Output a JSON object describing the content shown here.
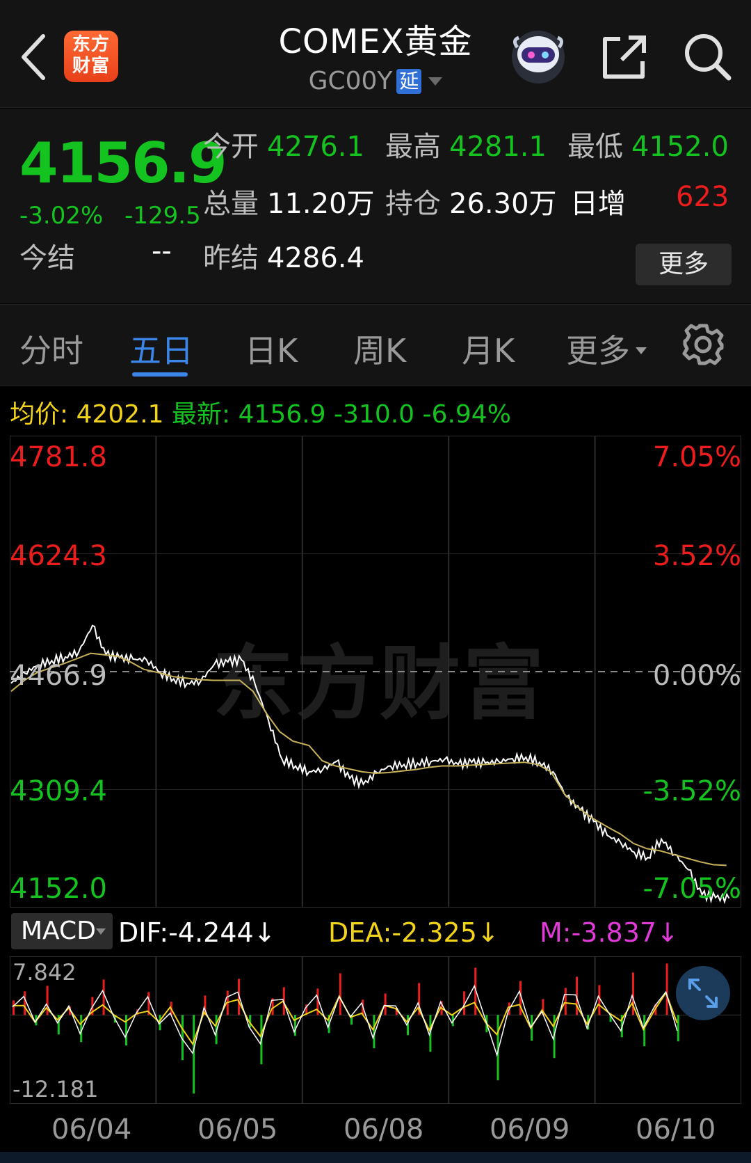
{
  "header": {
    "logo_line1": "东方",
    "logo_line2": "财富",
    "title": "COMEX黄金",
    "code": "GC00Y",
    "delay_badge": "延"
  },
  "quote": {
    "last": "4156.9",
    "change_pct": "-3.02%",
    "change_abs": "-129.5",
    "open_label": "今开",
    "open": "4276.1",
    "high_label": "最高",
    "high": "4281.1",
    "low_label": "最低",
    "low": "4152.0",
    "volume_label": "总量",
    "volume": "11.20万",
    "oi_label": "持仓",
    "oi": "26.30万",
    "daily_inc_label": "日增",
    "daily_inc": "623",
    "settle_label": "今结",
    "settle": "--",
    "prev_settle_label": "昨结",
    "prev_settle": "4286.4",
    "more_label": "更多"
  },
  "tabs": [
    {
      "label": "分时"
    },
    {
      "label": "五日"
    },
    {
      "label": "日K"
    },
    {
      "label": "周K"
    },
    {
      "label": "月K"
    },
    {
      "label": "更多"
    }
  ],
  "active_tab": "五日",
  "infoline": {
    "avg_label": "均价:",
    "avg": "4202.1",
    "latest_label": "最新:",
    "latest": "4156.9",
    "latest_change": "-310.0",
    "latest_pct": "-6.94%"
  },
  "watermark": "东方财富",
  "chart_data": {
    "type": "line",
    "y_left_ticks": [
      "4781.8",
      "4624.3",
      "4466.9",
      "4309.4",
      "4152.0"
    ],
    "y_right_ticks": [
      "7.05%",
      "3.52%",
      "0.00%",
      "-3.52%",
      "-7.05%"
    ],
    "ylim": [
      4152.0,
      4781.8
    ],
    "reference": 4466.9,
    "categories": [
      "06/04",
      "06/05",
      "06/08",
      "06/09",
      "06/10"
    ],
    "series": [
      {
        "name": "price",
        "color": "#ffffff",
        "values": [
          4451,
          4465,
          4476,
          4482,
          4487,
          4494,
          4530,
          4490,
          4486,
          4484,
          4483,
          4466,
          4457,
          4451,
          4454,
          4477,
          4480,
          4483,
          4450,
          4400,
          4347,
          4338,
          4330,
          4333,
          4344,
          4321,
          4313,
          4329,
          4338,
          4340,
          4342,
          4344,
          4347,
          4340,
          4343,
          4342,
          4344,
          4348,
          4350,
          4343,
          4330,
          4296,
          4278,
          4262,
          4243,
          4233,
          4220,
          4213,
          4238,
          4217,
          4196,
          4162,
          4158,
          4157
        ]
      },
      {
        "name": "avg",
        "color": "#c8b25a",
        "values": [
          4440,
          4455,
          4466,
          4472,
          4478,
          4485,
          4492,
          4490,
          4488,
          4480,
          4470,
          4465,
          4460,
          4458,
          4456,
          4455,
          4455,
          4455,
          4440,
          4410,
          4385,
          4372,
          4366,
          4345,
          4338,
          4334,
          4330,
          4328,
          4329,
          4331,
          4333,
          4336,
          4338,
          4338,
          4339,
          4340,
          4341,
          4342,
          4343,
          4340,
          4330,
          4300,
          4282,
          4268,
          4255,
          4245,
          4232,
          4225,
          4222,
          4217,
          4212,
          4207,
          4203,
          4202
        ]
      }
    ]
  },
  "macd": {
    "indicator": "MACD",
    "dif_label": "DIF:-4.244↓",
    "dea_label": "DEA:-2.325↓",
    "m_label": "M:-3.837↓",
    "max_label": "7.842",
    "min_label": "-12.181",
    "ylim": [
      -12.181,
      7.842
    ],
    "colors": {
      "up": "#ee1d1d",
      "down": "#14c31f",
      "dif": "#ffffff",
      "dea": "#f2d319"
    },
    "hist": [
      2.1,
      3.4,
      -1.5,
      4.2,
      -2.8,
      1.2,
      -3.9,
      2.6,
      5.1,
      -1.1,
      -4.4,
      0.8,
      3.3,
      -2.2,
      1.9,
      -6.5,
      -11.3,
      2.8,
      -4.2,
      3.5,
      5.2,
      -1.8,
      -7.1,
      2.4,
      4.0,
      -3.0,
      1.5,
      3.8,
      -2.6,
      6.0,
      -1.4,
      2.2,
      -4.8,
      3.1,
      1.0,
      -2.9,
      4.6,
      -5.3,
      2.0,
      -1.6,
      3.4,
      6.8,
      -2.5,
      -9.4,
      1.8,
      4.9,
      -3.7,
      2.3,
      -6.2,
      3.9,
      5.5,
      -2.1,
      4.3,
      -1.0,
      -3.2,
      6.1,
      -4.5,
      1.6,
      7.4,
      -3.8
    ]
  },
  "dates": [
    "06/04",
    "06/05",
    "06/08",
    "06/09",
    "06/10"
  ]
}
